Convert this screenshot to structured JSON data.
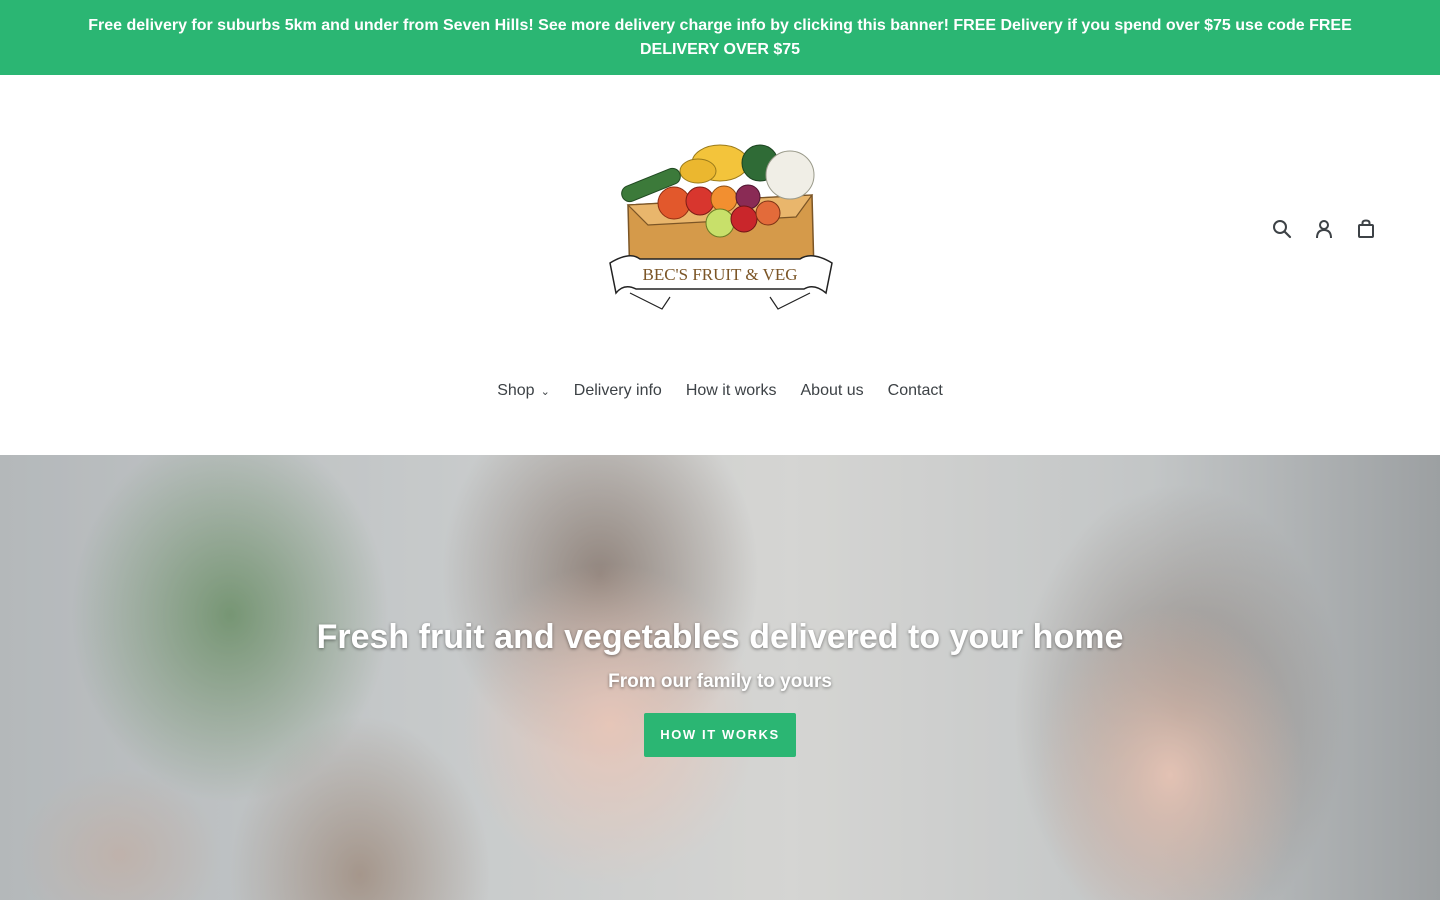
{
  "announcement": {
    "text": "Free delivery for suburbs 5km and under from Seven Hills! See more delivery charge info by clicking this banner! FREE Delivery if you spend over $75 use code FREE DELIVERY OVER $75"
  },
  "header": {
    "logo_text": "BEC'S FRUIT & VEG",
    "icons": [
      "search-icon",
      "account-icon",
      "cart-icon"
    ]
  },
  "nav": {
    "items": [
      {
        "label": "Shop",
        "has_dropdown": true
      },
      {
        "label": "Delivery info"
      },
      {
        "label": "How it works"
      },
      {
        "label": "About us"
      },
      {
        "label": "Contact"
      }
    ]
  },
  "hero": {
    "title": "Fresh fruit and vegetables delivered to your home",
    "subtitle": "From our family to yours",
    "button_label": "HOW IT WORKS"
  },
  "colors": {
    "accent": "#2bb673",
    "text": "#3d4246"
  }
}
